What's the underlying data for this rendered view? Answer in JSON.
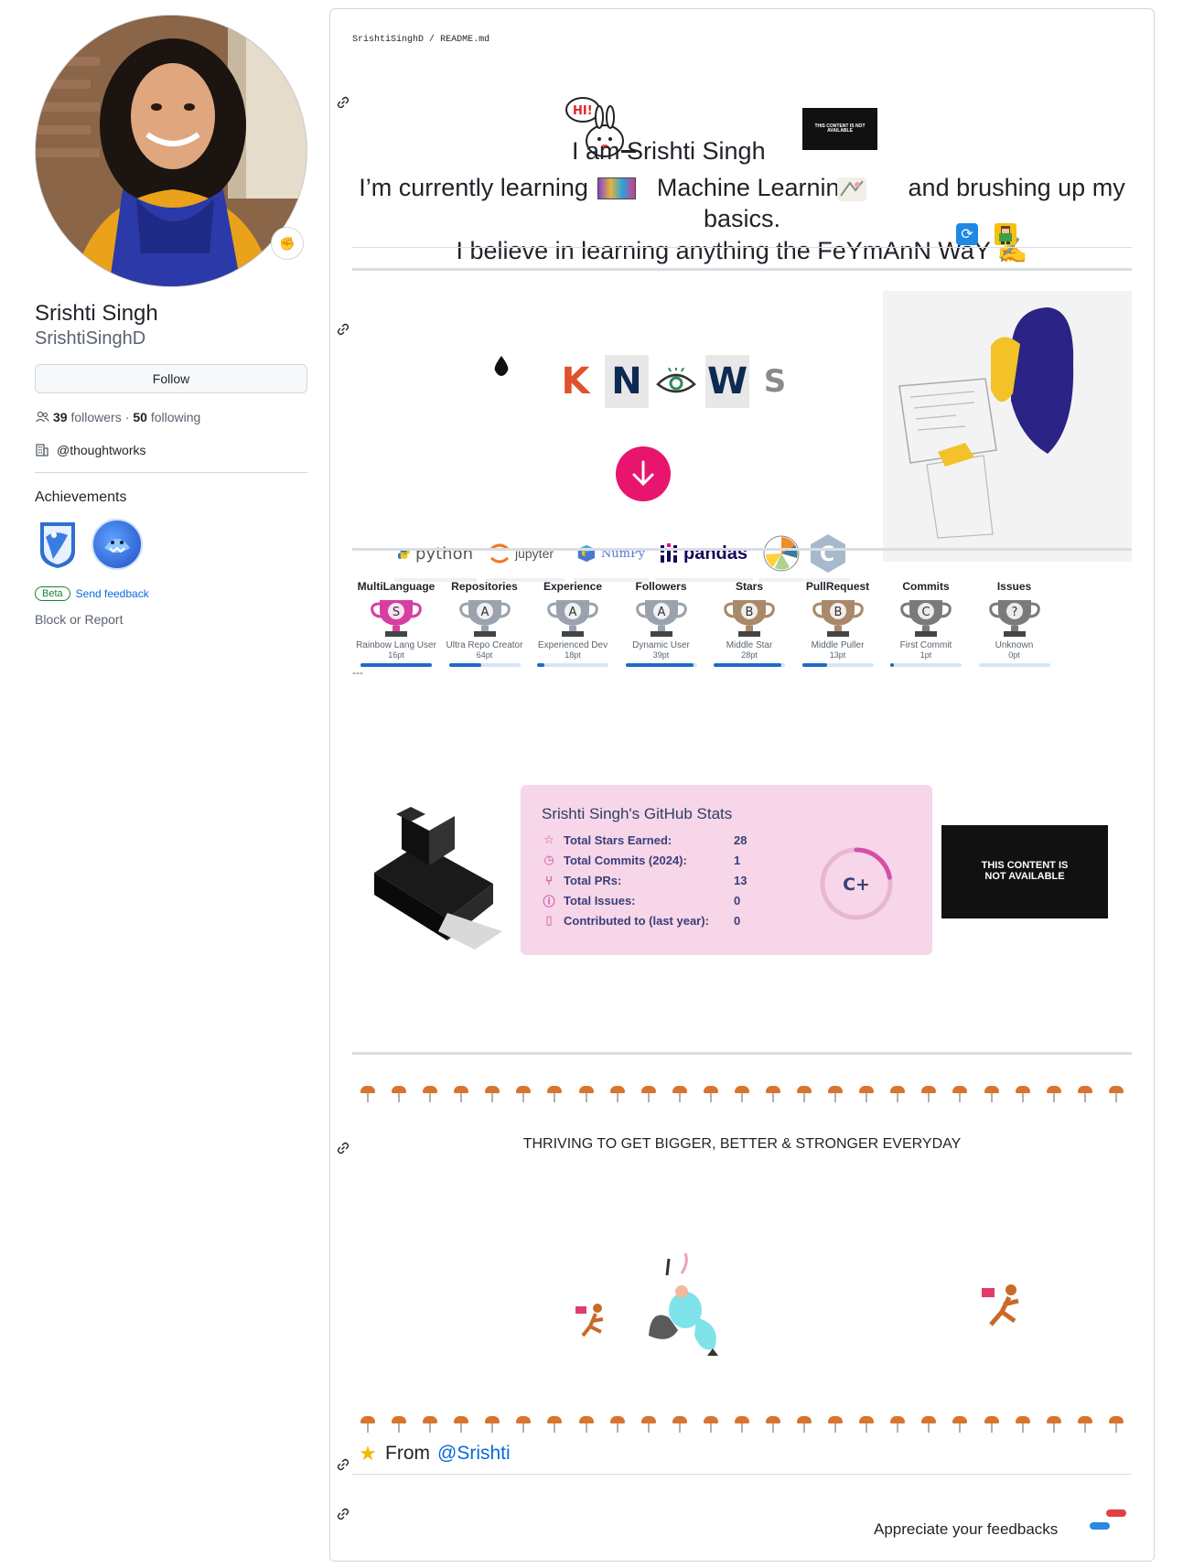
{
  "profile": {
    "name": "Srishti Singh",
    "login": "SrishtiSinghD",
    "follow_label": "Follow",
    "followers_count": "39",
    "followers_label": "followers",
    "separator": "·",
    "following_count": "50",
    "following_label": "following",
    "organization": "@thoughtworks",
    "achievements_title": "Achievements",
    "beta_label": "Beta",
    "send_feedback_label": "Send feedback",
    "block_label": "Block or Report",
    "status_icon": "flexed-biceps-icon"
  },
  "readme": {
    "breadcrumb_owner": "SrishtiSinghD",
    "breadcrumb_sep": "/",
    "breadcrumb_file": "README.md",
    "hi_bubble": "HI!",
    "intro_line1": "I am Srishti Singh",
    "intro_line2": "I’m currently learning          Machine Learning        and brushing up my basics.",
    "intro_line3": "I believe in learning anything the FeYmAnN WaY ✍️",
    "not_available_text": "THIS CONTENT IS NOT AVAILABLE",
    "tile_letters": [
      "K",
      "N",
      "W",
      "S"
    ],
    "tech": {
      "python": "python",
      "jupyter": "jupyter",
      "numpy": "NumPy",
      "pandas": "pandas"
    },
    "separator_dashes": "---",
    "thrive_text": "THRIVING TO GET BIGGER, BETTER & STRONGER EVERYDAY",
    "from_prefix": "From",
    "from_handle": "@Srishti",
    "appreciate_text": "Appreciate your feedbacks"
  },
  "trophies": [
    {
      "title": "MultiLanguage",
      "letter": "S",
      "rank": "Rainbow Lang User",
      "points": "16pt",
      "progress": 1.0,
      "color": "#d63fa0"
    },
    {
      "title": "Repositories",
      "letter": "A",
      "rank": "Ultra Repo Creator",
      "points": "64pt",
      "progress": 0.45,
      "color": "#9aa3ad"
    },
    {
      "title": "Experience",
      "letter": "A",
      "rank": "Experienced Dev",
      "points": "18pt",
      "progress": 0.1,
      "color": "#9aa3ad"
    },
    {
      "title": "Followers",
      "letter": "A",
      "rank": "Dynamic User",
      "points": "39pt",
      "progress": 0.95,
      "color": "#9aa3ad"
    },
    {
      "title": "Stars",
      "letter": "B",
      "rank": "Middle Star",
      "points": "28pt",
      "progress": 0.95,
      "color": "#a8896a"
    },
    {
      "title": "PullRequest",
      "letter": "B",
      "rank": "Middle Puller",
      "points": "13pt",
      "progress": 0.35,
      "color": "#a8896a"
    },
    {
      "title": "Commits",
      "letter": "C",
      "rank": "First Commit",
      "points": "1pt",
      "progress": 0.05,
      "color": "#7a7a7a"
    },
    {
      "title": "Issues",
      "letter": "?",
      "rank": "Unknown",
      "points": "0pt",
      "progress": 0.0,
      "color": "#7a7a7a"
    }
  ],
  "stats": {
    "title": "Srishti Singh's GitHub Stats",
    "rows": [
      {
        "icon": "star-icon",
        "label": "Total Stars Earned:",
        "value": "28"
      },
      {
        "icon": "clock-icon",
        "label": "Total Commits (2024):",
        "value": "1"
      },
      {
        "icon": "pull-request-icon",
        "label": "Total PRs:",
        "value": "13"
      },
      {
        "icon": "issue-icon",
        "label": "Total Issues:",
        "value": "0"
      },
      {
        "icon": "repo-icon",
        "label": "Contributed to (last year):",
        "value": "0"
      }
    ],
    "grade": "C+",
    "grade_progress": 0.22,
    "accent": "#d34fa6",
    "card_bg": "#f6d6e8"
  },
  "colors": {
    "link": "#0969da",
    "border": "#d0d7de",
    "muted": "#59636e"
  }
}
